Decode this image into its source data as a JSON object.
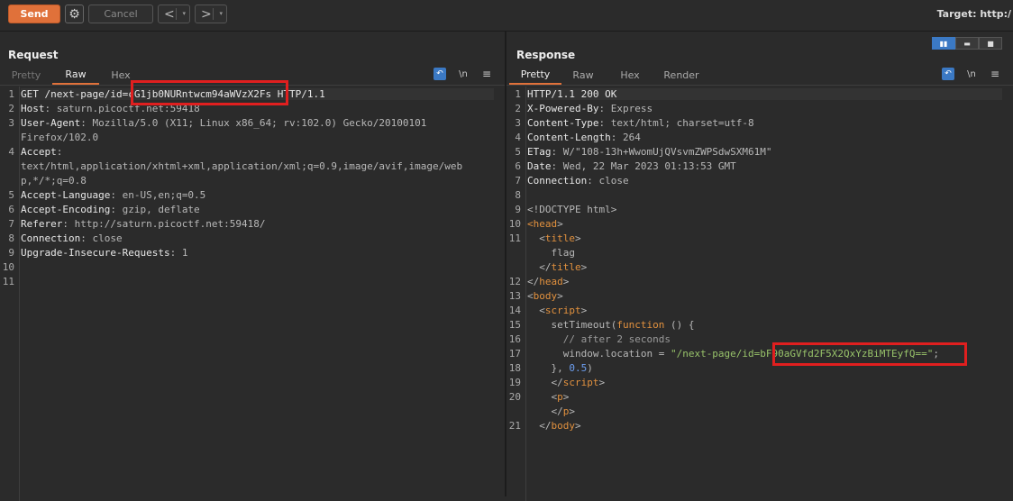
{
  "toolbar": {
    "send_label": "Send",
    "cancel_label": "Cancel",
    "back_arrow": "<",
    "forward_arrow": ">",
    "dropdown_glyph": "▾",
    "target_label": "Target: http:/"
  },
  "request": {
    "title": "Request",
    "tabs": [
      "Pretty",
      "Raw",
      "Hex"
    ],
    "active_tab": "Raw",
    "newline_toggle": "\\n",
    "lines": [
      {
        "n": "1",
        "key": "GET /next-page/id=cG1jb0NURntwcm94aWVzX2Fs HTTP/1.1",
        "val": ""
      },
      {
        "n": "2",
        "key": "Host",
        "val": ": saturn.picoctf.net:59418"
      },
      {
        "n": "3",
        "key": "User-Agent",
        "val": ": Mozilla/5.0 (X11; Linux x86_64; rv:102.0) Gecko/20100101"
      },
      {
        "n": "",
        "key": "",
        "val": "Firefox/102.0"
      },
      {
        "n": "4",
        "key": "Accept",
        "val": ":"
      },
      {
        "n": "",
        "key": "",
        "val": "text/html,application/xhtml+xml,application/xml;q=0.9,image/avif,image/web"
      },
      {
        "n": "",
        "key": "",
        "val": "p,*/*;q=0.8"
      },
      {
        "n": "5",
        "key": "Accept-Language",
        "val": ": en-US,en;q=0.5"
      },
      {
        "n": "6",
        "key": "Accept-Encoding",
        "val": ": gzip, deflate"
      },
      {
        "n": "7",
        "key": "Referer",
        "val": ": http://saturn.picoctf.net:59418/"
      },
      {
        "n": "8",
        "key": "Connection",
        "val": ": close"
      },
      {
        "n": "9",
        "key": "Upgrade-Insecure-Requests",
        "val": ": 1"
      },
      {
        "n": "10",
        "key": "",
        "val": ""
      },
      {
        "n": "11",
        "key": "",
        "val": ""
      }
    ]
  },
  "response": {
    "title": "Response",
    "tabs": [
      "Pretty",
      "Raw",
      "Hex",
      "Render"
    ],
    "active_tab": "Pretty",
    "newline_toggle": "\\n",
    "lines": [
      {
        "n": "1",
        "segs": [
          [
            "k",
            "HTTP/1.1 200 OK"
          ]
        ]
      },
      {
        "n": "2",
        "segs": [
          [
            "k",
            "X-Powered-By"
          ],
          [
            "v",
            ": Express"
          ]
        ]
      },
      {
        "n": "3",
        "segs": [
          [
            "k",
            "Content-Type"
          ],
          [
            "v",
            ": text/html; charset=utf-8"
          ]
        ]
      },
      {
        "n": "4",
        "segs": [
          [
            "k",
            "Content-Length"
          ],
          [
            "v",
            ": 264"
          ]
        ]
      },
      {
        "n": "5",
        "segs": [
          [
            "k",
            "ETag"
          ],
          [
            "v",
            ": W/\"108-13h+WwomUjQVsvmZWPSdwSXM61M\""
          ]
        ]
      },
      {
        "n": "6",
        "segs": [
          [
            "k",
            "Date"
          ],
          [
            "v",
            ": Wed, 22 Mar 2023 01:13:53 GMT"
          ]
        ]
      },
      {
        "n": "7",
        "segs": [
          [
            "k",
            "Connection"
          ],
          [
            "v",
            ": close"
          ]
        ]
      },
      {
        "n": "8",
        "segs": []
      },
      {
        "n": "9",
        "segs": [
          [
            "v",
            "<!DOCTYPE html>"
          ]
        ]
      },
      {
        "n": "10",
        "segs": [
          [
            "tag",
            "<head"
          ],
          [
            "v",
            ">"
          ]
        ]
      },
      {
        "n": "11",
        "segs": [
          [
            "v",
            "  <"
          ],
          [
            "tag",
            "title"
          ],
          [
            "v",
            ">"
          ]
        ]
      },
      {
        "n": "",
        "segs": [
          [
            "v",
            "    flag"
          ]
        ]
      },
      {
        "n": "",
        "segs": [
          [
            "v",
            "  </"
          ],
          [
            "tag",
            "title"
          ],
          [
            "v",
            ">"
          ]
        ]
      },
      {
        "n": "12",
        "segs": [
          [
            "v",
            "</"
          ],
          [
            "tag",
            "head"
          ],
          [
            "v",
            ">"
          ]
        ]
      },
      {
        "n": "13",
        "segs": [
          [
            "v",
            "<"
          ],
          [
            "tag",
            "body"
          ],
          [
            "v",
            ">"
          ]
        ]
      },
      {
        "n": "14",
        "segs": [
          [
            "v",
            "  <"
          ],
          [
            "tag",
            "script"
          ],
          [
            "v",
            ">"
          ]
        ]
      },
      {
        "n": "15",
        "segs": [
          [
            "v",
            "    setTimeout("
          ],
          [
            "fn",
            "function"
          ],
          [
            "v",
            " () {"
          ]
        ]
      },
      {
        "n": "16",
        "segs": [
          [
            "cm",
            "      // after 2 seconds"
          ]
        ]
      },
      {
        "n": "17",
        "segs": [
          [
            "v",
            "      window.location = "
          ],
          [
            "str",
            "\"/next-page/id=bF90aGVfd2F5X2QxYzBiMTEyfQ==\""
          ],
          [
            "v",
            ";"
          ]
        ]
      },
      {
        "n": "18",
        "segs": [
          [
            "v",
            "    }, "
          ],
          [
            "num",
            "0.5"
          ],
          [
            "v",
            ")"
          ]
        ]
      },
      {
        "n": "19",
        "segs": [
          [
            "v",
            "    </"
          ],
          [
            "tag",
            "script"
          ],
          [
            "v",
            ">"
          ]
        ]
      },
      {
        "n": "20",
        "segs": [
          [
            "v",
            "    <"
          ],
          [
            "tag",
            "p"
          ],
          [
            "v",
            ">"
          ]
        ]
      },
      {
        "n": "",
        "segs": [
          [
            "v",
            "    </"
          ],
          [
            "tag",
            "p"
          ],
          [
            "v",
            ">"
          ]
        ]
      },
      {
        "n": "21",
        "segs": [
          [
            "v",
            "  </"
          ],
          [
            "tag",
            "body"
          ],
          [
            "v",
            ">"
          ]
        ]
      }
    ]
  },
  "colors": {
    "accent": "#e0713a",
    "highlight_box": "#e01f1f",
    "toggle_blue": "#3b79c4"
  }
}
